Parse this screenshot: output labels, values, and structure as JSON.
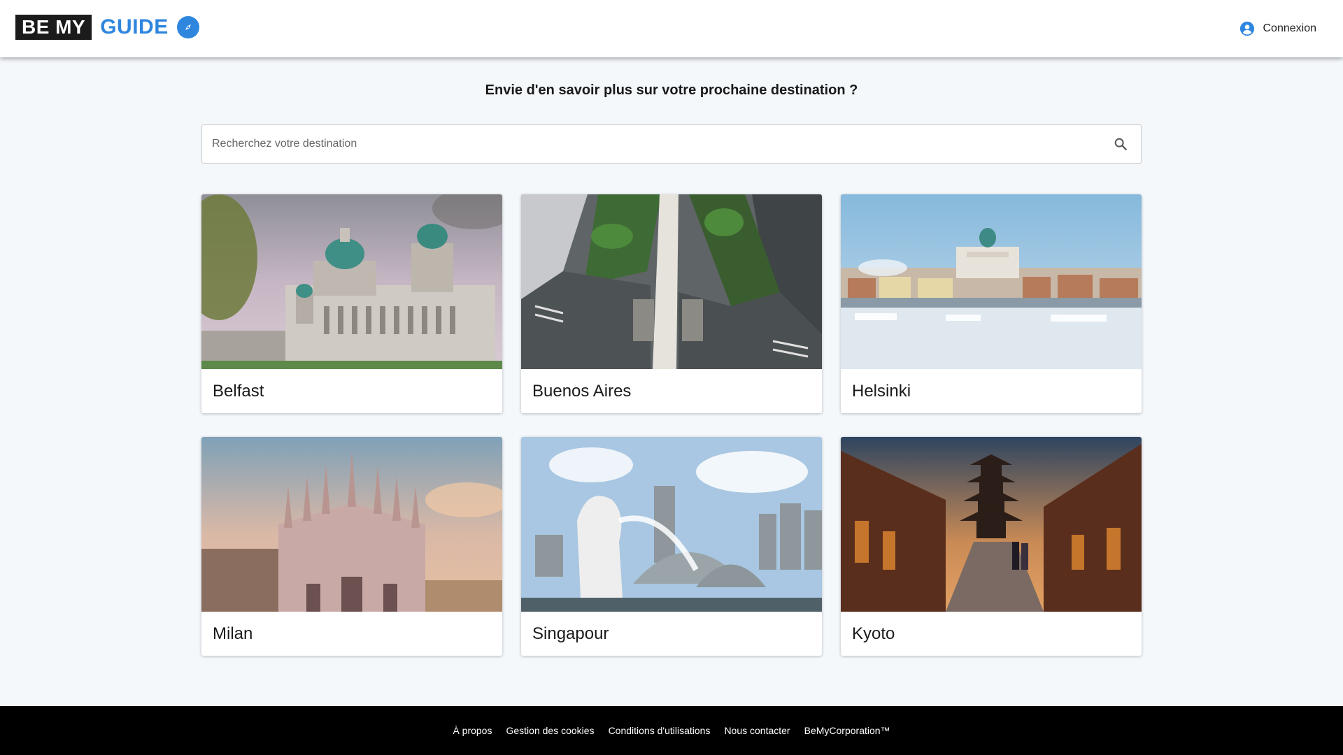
{
  "header": {
    "logo_be": "BE MY",
    "logo_guide": "GUIDE",
    "login_label": "Connexion"
  },
  "main": {
    "headline": "Envie d'en savoir plus sur votre prochaine destination ?",
    "search_placeholder": "Recherchez votre destination"
  },
  "destinations": [
    {
      "name": "Belfast"
    },
    {
      "name": "Buenos Aires"
    },
    {
      "name": "Helsinki"
    },
    {
      "name": "Milan"
    },
    {
      "name": "Singapour"
    },
    {
      "name": "Kyoto"
    }
  ],
  "footer": {
    "links": [
      "À propos",
      "Gestion des cookies",
      "Conditions d'utilisations",
      "Nous contacter",
      "BeMyCorporation™"
    ]
  },
  "colors": {
    "brand_blue": "#2f86de",
    "logo_dark": "#1b1b1b",
    "page_background": "#f4f8fb",
    "footer_background": "#000000"
  },
  "icons": {
    "logo": "compass-icon",
    "login": "account-circle-icon",
    "search": "search-icon"
  }
}
